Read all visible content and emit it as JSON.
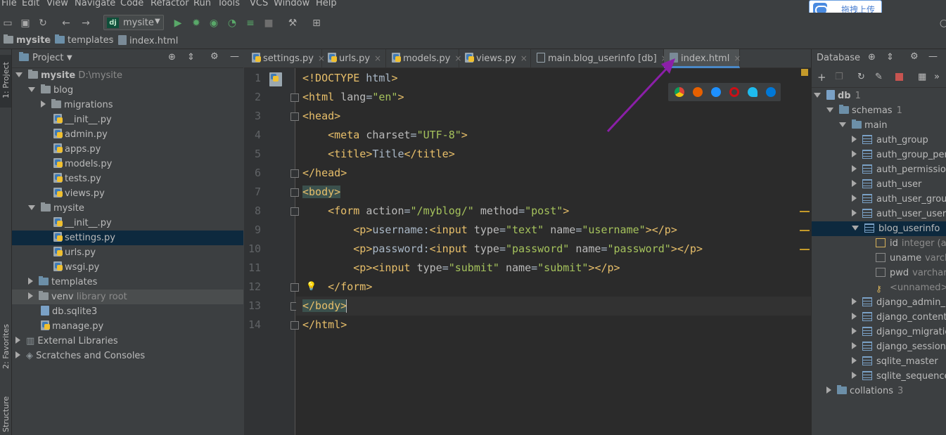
{
  "menu": [
    "File",
    "Edit",
    "View",
    "Navigate",
    "Code",
    "Refactor",
    "Run",
    "Tools",
    "VCS",
    "Window",
    "Help"
  ],
  "upload_widget": {
    "label": "拖拽上传"
  },
  "toolbar": {
    "run_config": "mysite",
    "dj_badge": "dj"
  },
  "breadcrumbs": [
    "mysite",
    "templates",
    "index.html"
  ],
  "left_strip": {
    "project": "1: Project",
    "favorites": "2: Favorites",
    "structure": "Structure"
  },
  "project_panel": {
    "title": "Project",
    "tree": [
      {
        "label": "mysite",
        "extra": "D:\\mysite",
        "kind": "folder",
        "depth": 0,
        "open": true
      },
      {
        "label": "blog",
        "kind": "folder",
        "depth": 1,
        "open": true
      },
      {
        "label": "migrations",
        "kind": "folder",
        "depth": 2,
        "open": false
      },
      {
        "label": "__init__.py",
        "kind": "py",
        "depth": 3
      },
      {
        "label": "admin.py",
        "kind": "py",
        "depth": 3
      },
      {
        "label": "apps.py",
        "kind": "py",
        "depth": 3
      },
      {
        "label": "models.py",
        "kind": "py",
        "depth": 3
      },
      {
        "label": "tests.py",
        "kind": "py",
        "depth": 3
      },
      {
        "label": "views.py",
        "kind": "py",
        "depth": 3
      },
      {
        "label": "mysite",
        "kind": "folder",
        "depth": 1,
        "open": true
      },
      {
        "label": "__init__.py",
        "kind": "py",
        "depth": 3
      },
      {
        "label": "settings.py",
        "kind": "py",
        "depth": 3,
        "selected": true
      },
      {
        "label": "urls.py",
        "kind": "py",
        "depth": 3
      },
      {
        "label": "wsgi.py",
        "kind": "py",
        "depth": 3
      },
      {
        "label": "templates",
        "kind": "folder-blue",
        "depth": 1,
        "open": false
      },
      {
        "label": "venv",
        "extra": "library root",
        "kind": "folder",
        "depth": 1,
        "open": false,
        "highlight": true
      },
      {
        "label": "db.sqlite3",
        "kind": "db",
        "depth": 2
      },
      {
        "label": "manage.py",
        "kind": "py",
        "depth": 2
      },
      {
        "label": "External Libraries",
        "kind": "lib",
        "depth": 0,
        "open": false
      },
      {
        "label": "Scratches and Consoles",
        "kind": "scratch",
        "depth": 0,
        "open": false
      }
    ]
  },
  "tabs": [
    {
      "label": "settings.py",
      "kind": "py"
    },
    {
      "label": "urls.py",
      "kind": "py"
    },
    {
      "label": "models.py",
      "kind": "py"
    },
    {
      "label": "views.py",
      "kind": "py"
    },
    {
      "label": "main.blog_userinfo [db]",
      "kind": "tbl"
    },
    {
      "label": "index.html",
      "kind": "html",
      "active": true
    }
  ],
  "editor": {
    "line_numbers": [
      "1",
      "2",
      "3",
      "4",
      "5",
      "6",
      "7",
      "8",
      "9",
      "10",
      "11",
      "12",
      "13",
      "14"
    ],
    "lines": [
      "<!DOCTYPE html>",
      "<html lang=\"en\">",
      "<head>",
      "    <meta charset=\"UTF-8\">",
      "    <title>Title</title>",
      "</head>",
      "<body>",
      "    <form action=\"/myblog/\" method=\"post\">",
      "        <p>username:<input type=\"text\" name=\"username\"></p>",
      "        <p>password:<input type=\"password\" name=\"password\"></p>",
      "        <p><input type=\"submit\" name=\"submit\"></p>",
      "    </form>",
      "</body>",
      "</html>"
    ],
    "current_line": 13,
    "browsers": [
      "chrome",
      "firefox",
      "safari",
      "opera",
      "ie",
      "edge"
    ],
    "colors": {
      "tag": "#e8bf6a",
      "attr": "#bababa",
      "value": "#a5c25c",
      "text": "#a9b7c6",
      "arrow": "#8b1fa8"
    }
  },
  "database_panel": {
    "title": "Database",
    "tree": [
      {
        "label": "db",
        "count": "1",
        "kind": "db",
        "depth": 0,
        "open": true
      },
      {
        "label": "schemas",
        "count": "1",
        "kind": "folder",
        "depth": 1,
        "open": true
      },
      {
        "label": "main",
        "kind": "schema",
        "depth": 2,
        "open": true
      },
      {
        "label": "auth_group",
        "kind": "table",
        "depth": 3,
        "open": false
      },
      {
        "label": "auth_group_per",
        "kind": "table",
        "depth": 3,
        "open": false
      },
      {
        "label": "auth_permission",
        "kind": "table",
        "depth": 3,
        "open": false
      },
      {
        "label": "auth_user",
        "kind": "table",
        "depth": 3,
        "open": false
      },
      {
        "label": "auth_user_group",
        "kind": "table",
        "depth": 3,
        "open": false
      },
      {
        "label": "auth_user_user_",
        "kind": "table",
        "depth": 3,
        "open": false
      },
      {
        "label": "blog_userinfo",
        "kind": "table",
        "depth": 3,
        "open": true,
        "selected": true
      },
      {
        "label": "id",
        "type": "integer (a",
        "kind": "pk",
        "depth": 4
      },
      {
        "label": "uname",
        "type": "varch",
        "kind": "col",
        "depth": 4
      },
      {
        "label": "pwd",
        "type": "varchar",
        "kind": "col",
        "depth": 4
      },
      {
        "label": "<unnamed>",
        "kind": "key",
        "depth": 4
      },
      {
        "label": "django_admin_l",
        "kind": "table",
        "depth": 3,
        "open": false
      },
      {
        "label": "django_content",
        "kind": "table",
        "depth": 3,
        "open": false
      },
      {
        "label": "django_migratic",
        "kind": "table",
        "depth": 3,
        "open": false
      },
      {
        "label": "django_session",
        "kind": "table",
        "depth": 3,
        "open": false
      },
      {
        "label": "sqlite_master",
        "kind": "table",
        "depth": 3,
        "open": false
      },
      {
        "label": "sqlite_sequence",
        "kind": "table",
        "depth": 3,
        "open": false
      },
      {
        "label": "collations",
        "count": "3",
        "kind": "folder",
        "depth": 1,
        "open": false
      }
    ]
  }
}
